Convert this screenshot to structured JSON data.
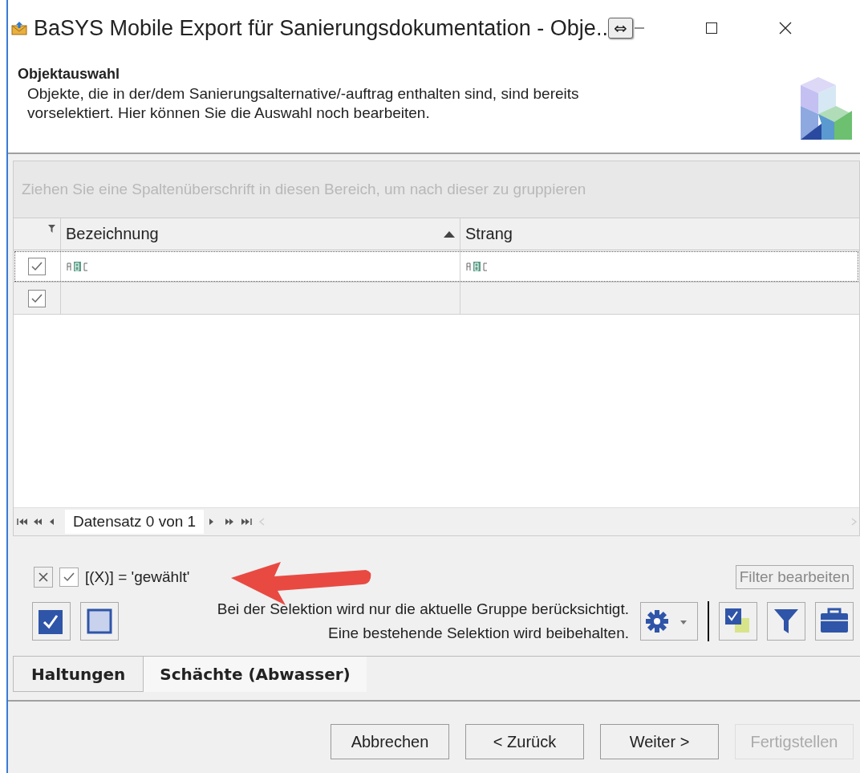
{
  "window": {
    "title": "BaSYS Mobile Export für Sanierungsdokumentation - Obje..",
    "overlay_glyph": "⇔"
  },
  "header": {
    "title": "Objektauswahl",
    "description": "Objekte, die in der/dem Sanierungsalternative/-auftrag enthalten sind, sind bereits vorselektiert. Hier können Sie die Auswahl noch bearbeiten."
  },
  "grid": {
    "group_panel_hint": "Ziehen Sie eine Spaltenüberschrift in diesen Bereich, um nach dieser zu gruppieren",
    "columns": [
      {
        "label": "Bezeichnung",
        "sorted": true
      },
      {
        "label": "Strang",
        "sorted": false
      }
    ],
    "rows": [
      {
        "checked": true,
        "selected": true,
        "cells": [
          {
            "kind": "abc"
          },
          {
            "kind": "abc"
          }
        ]
      },
      {
        "checked": true,
        "selected": false,
        "cells": [
          {
            "kind": "empty"
          },
          {
            "kind": "empty"
          }
        ]
      }
    ],
    "navigator": {
      "text": "Datensatz 0 von 1"
    }
  },
  "filter": {
    "enabled": true,
    "expression": "[(X)] = 'gewählt'",
    "edit_button": "Filter bearbeiten"
  },
  "selection_hint": [
    "Bei der Selektion wird nur die aktuelle Gruppe berücksichtigt.",
    "Eine bestehende Selektion wird beibehalten."
  ],
  "tabs": [
    {
      "label": "Haltungen",
      "selected": true
    },
    {
      "label": "Schächte (Abwasser)",
      "selected": false
    }
  ],
  "buttons": [
    {
      "label": "Abbrechen",
      "disabled": false
    },
    {
      "label": "< Zurück",
      "disabled": false
    },
    {
      "label": "Weiter >",
      "disabled": false
    },
    {
      "label": "Fertigstellen",
      "disabled": true
    }
  ]
}
